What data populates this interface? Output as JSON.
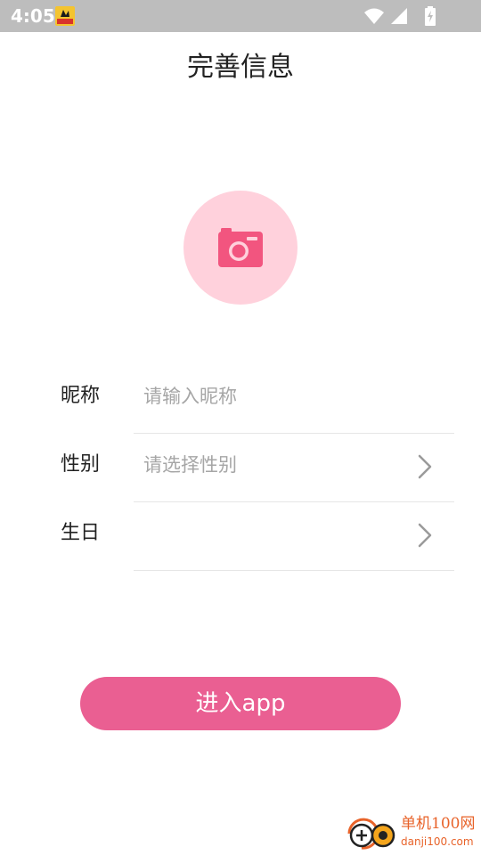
{
  "status_bar": {
    "time": "4:05"
  },
  "header": {
    "title": "完善信息"
  },
  "form": {
    "nickname": {
      "label": "昵称",
      "placeholder": "请输入昵称"
    },
    "gender": {
      "label": "性别",
      "placeholder": "请选择性别"
    },
    "birthday": {
      "label": "生日",
      "value": ""
    }
  },
  "actions": {
    "enter_label": "进入app"
  },
  "watermark": {
    "name": "单机100网",
    "url": "danji100.com"
  },
  "colors": {
    "accent": "#ea5f92",
    "avatar_bg": "#ffd1dc",
    "camera_icon": "#f2557f",
    "status_bar": "#bdbdbd"
  }
}
